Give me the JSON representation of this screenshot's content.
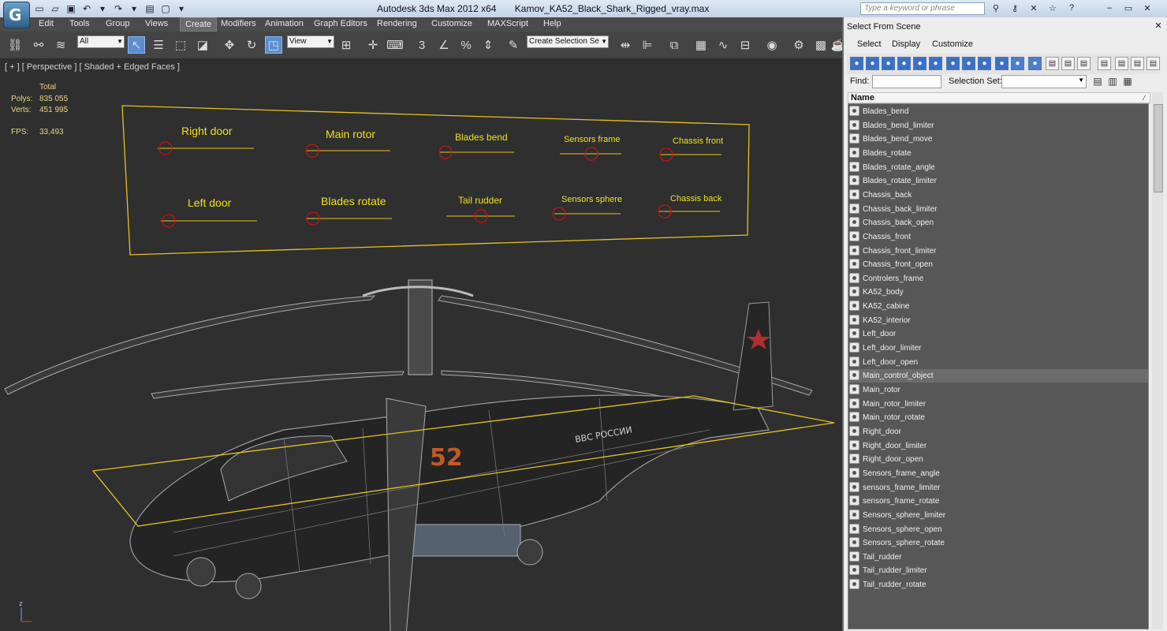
{
  "titlebar": {
    "app_title": "Autodesk 3ds Max  2012 x64",
    "file_name": "Kamov_KA52_Black_Shark_Rigged_vray.max",
    "search_placeholder": "Type a keyword or phrase"
  },
  "menu": [
    "Edit",
    "Tools",
    "Group",
    "Views",
    "Create",
    "Modifiers",
    "Animation",
    "Graph Editors",
    "Rendering",
    "Customize",
    "MAXScript",
    "Help"
  ],
  "menu_active": "Create",
  "toolbar": {
    "filter_value": "All",
    "ref_coord_value": "View",
    "selection_set_value": "Create Selection Se"
  },
  "viewport": {
    "label": "[ + ] [ Perspective ] [ Shaded + Edged Faces ]",
    "stats": {
      "total_label": "Total",
      "polys_label": "Polys:",
      "polys_value": "835 055",
      "verts_label": "Verts:",
      "verts_value": "451 995",
      "fps_label": "FPS:",
      "fps_value": "33,493"
    },
    "controls_top": [
      "Right door",
      "Main rotor",
      "Blades bend",
      "Sensors frame",
      "Chassis front"
    ],
    "controls_bottom": [
      "Left door",
      "Blades rotate",
      "Tail rudder",
      "Sensors sphere",
      "Chassis back"
    ],
    "fuselage_number": "52",
    "side_text": "ВВС РОССИИ",
    "axis_label": "z"
  },
  "panel": {
    "title": "Select From Scene",
    "menu": [
      "Select",
      "Display",
      "Customize"
    ],
    "find_label": "Find:",
    "selection_set_label": "Selection Set:",
    "column_name": "Name",
    "highlighted": "Main_control_object",
    "objects": [
      "Blades_bend",
      "Blades_bend_limiter",
      "Blades_bend_move",
      "Blades_rotate",
      "Blades_rotate_angle",
      "Blades_rotate_limiter",
      "Chassis_back",
      "Chassis_back_limiter",
      "Chassis_back_open",
      "Chassis_front",
      "Chassis_front_limiter",
      "Chassis_front_open",
      "Controlers_frame",
      "KA52_body",
      "KA52_cabine",
      "KA52_interior",
      "Left_door",
      "Left_door_limiter",
      "Left_door_open",
      "Main_control_object",
      "Main_rotor",
      "Main_rotor_limiter",
      "Main_rotor_rotate",
      "Right_door",
      "Right_door_limiter",
      "Right_door_open",
      "Sensors_frame_angle",
      "sensors_frame_limiter",
      "sensors_frame_rotate",
      "Sensors_sphere_limiter",
      "Sensors_sphere_open",
      "Sensors_sphere_rotate",
      "Tail_rudder",
      "Tail_rudder_limiter",
      "Tail_rudder_rotate"
    ]
  },
  "colors": {
    "highlight_yellow": "#e8c020",
    "control_red": "#d01010",
    "label_yellow": "#f0e020",
    "list_bg": "#575757",
    "star_red": "#b03030",
    "number_orange": "#c05a2a"
  }
}
